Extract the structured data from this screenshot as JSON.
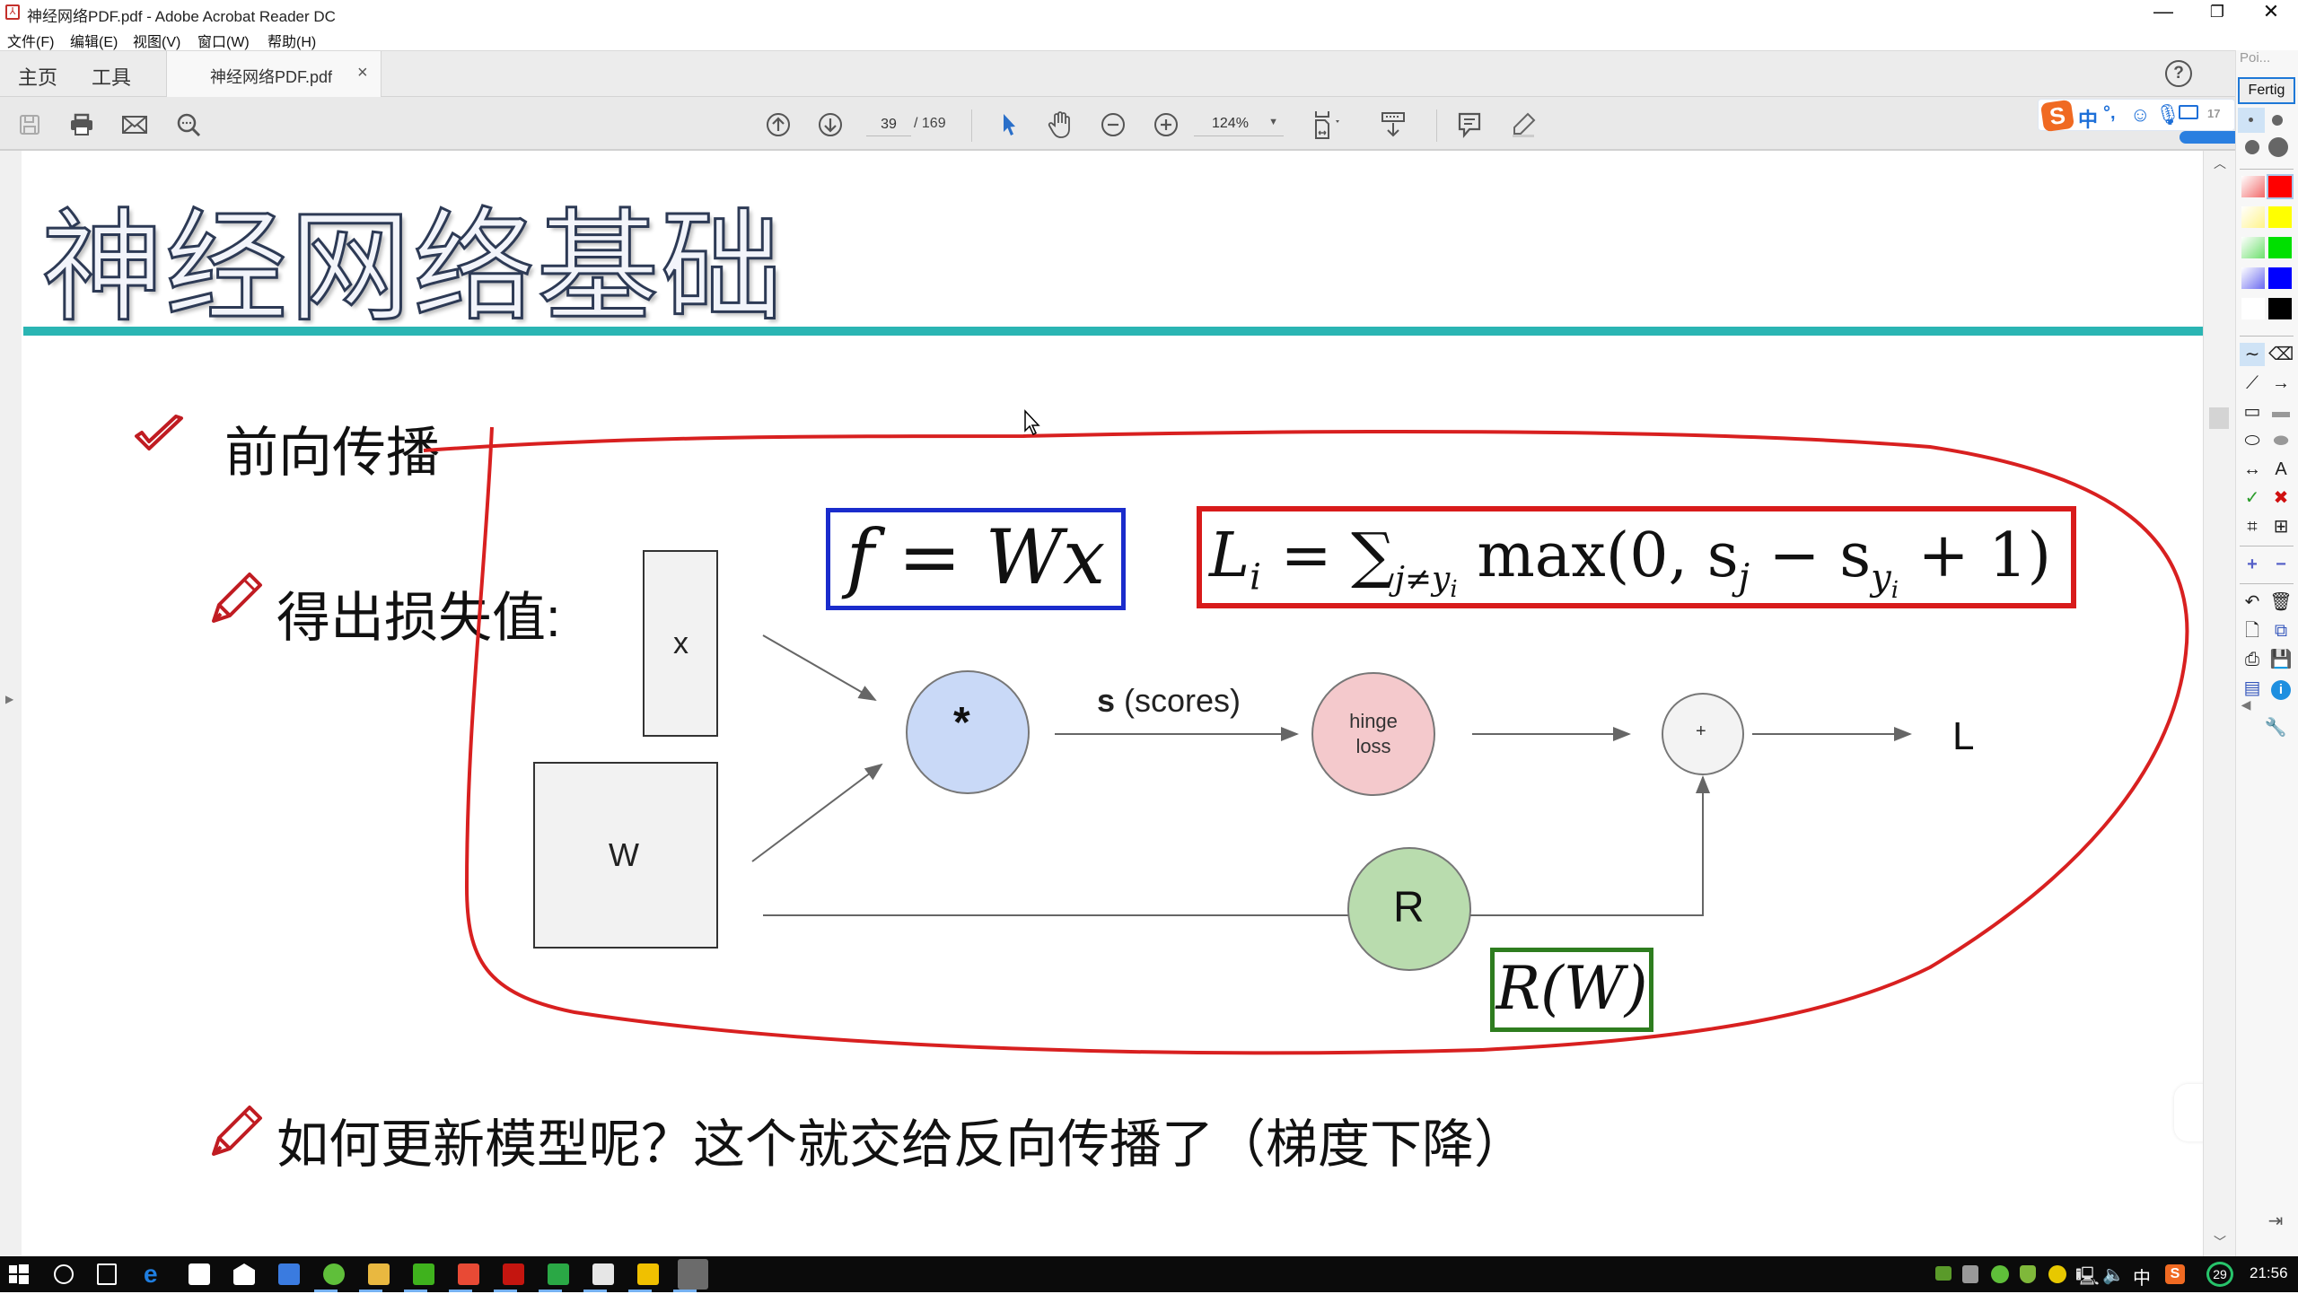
{
  "window": {
    "title": "神经网络PDF.pdf - Adobe Acrobat Reader DC",
    "minimize": "—",
    "restore": "❐",
    "close": "✕"
  },
  "menu": [
    "文件(F)",
    "编辑(E)",
    "视图(V)",
    "窗口(W)",
    "帮助(H)"
  ],
  "tabs": {
    "home": "主页",
    "tools": "工具",
    "document": "神经网络PDF.pdf",
    "close": "×",
    "help": "?"
  },
  "toolbar": {
    "current_page": "39",
    "total_pages": "/ 169",
    "zoom": "124%"
  },
  "ime": {
    "label": "中",
    "punct": "°,",
    "badge": "17"
  },
  "pointer_panel": {
    "title": "Poi...",
    "done": "Fertig",
    "colors": [
      {
        "name": "red-light",
        "hex": "#f26a6a"
      },
      {
        "name": "red",
        "hex": "#ff0000"
      },
      {
        "name": "yellow-light",
        "hex": "#fff48a"
      },
      {
        "name": "yellow",
        "hex": "#ffff00"
      },
      {
        "name": "green-light",
        "hex": "#6ee06e"
      },
      {
        "name": "green",
        "hex": "#00e000"
      },
      {
        "name": "blue-light",
        "hex": "#6a6af0"
      },
      {
        "name": "blue",
        "hex": "#0000ff"
      },
      {
        "name": "white",
        "hex": "#ffffff"
      },
      {
        "name": "black",
        "hex": "#000000"
      }
    ]
  },
  "slide": {
    "title": "神经网络基础",
    "accent": "#2ab5b3",
    "bullet1": "前向传播",
    "bullet2": "得出损失值:",
    "bullet3": "如何更新模型呢？这个就交给反向传播了（梯度下降）",
    "formula1": "f = Wx",
    "formula2_lhs": "L",
    "formula2_sub": "i",
    "formula2_eq": " = ∑",
    "formula2_sumsub": "j≠y",
    "formula2_sumsub2": "i",
    "formula2_rhs": " max(0, s",
    "formula2_sj": "j",
    "formula2_minus": " − s",
    "formula2_syi": "y",
    "formula2_syi2": "i",
    "formula2_end": " + 1)",
    "formula3": "R(W)",
    "diagram": {
      "x_label": "x",
      "w_label": "W",
      "mult_label": "*",
      "scores_bold": "s",
      "scores_rest": " (scores)",
      "hinge_line1": "hinge",
      "hinge_line2": "loss",
      "plus_label": "+",
      "loss_label": "L",
      "reg_label": "R"
    }
  },
  "taskbar": {
    "time": "21:56",
    "lang": "中",
    "badge": "29"
  }
}
